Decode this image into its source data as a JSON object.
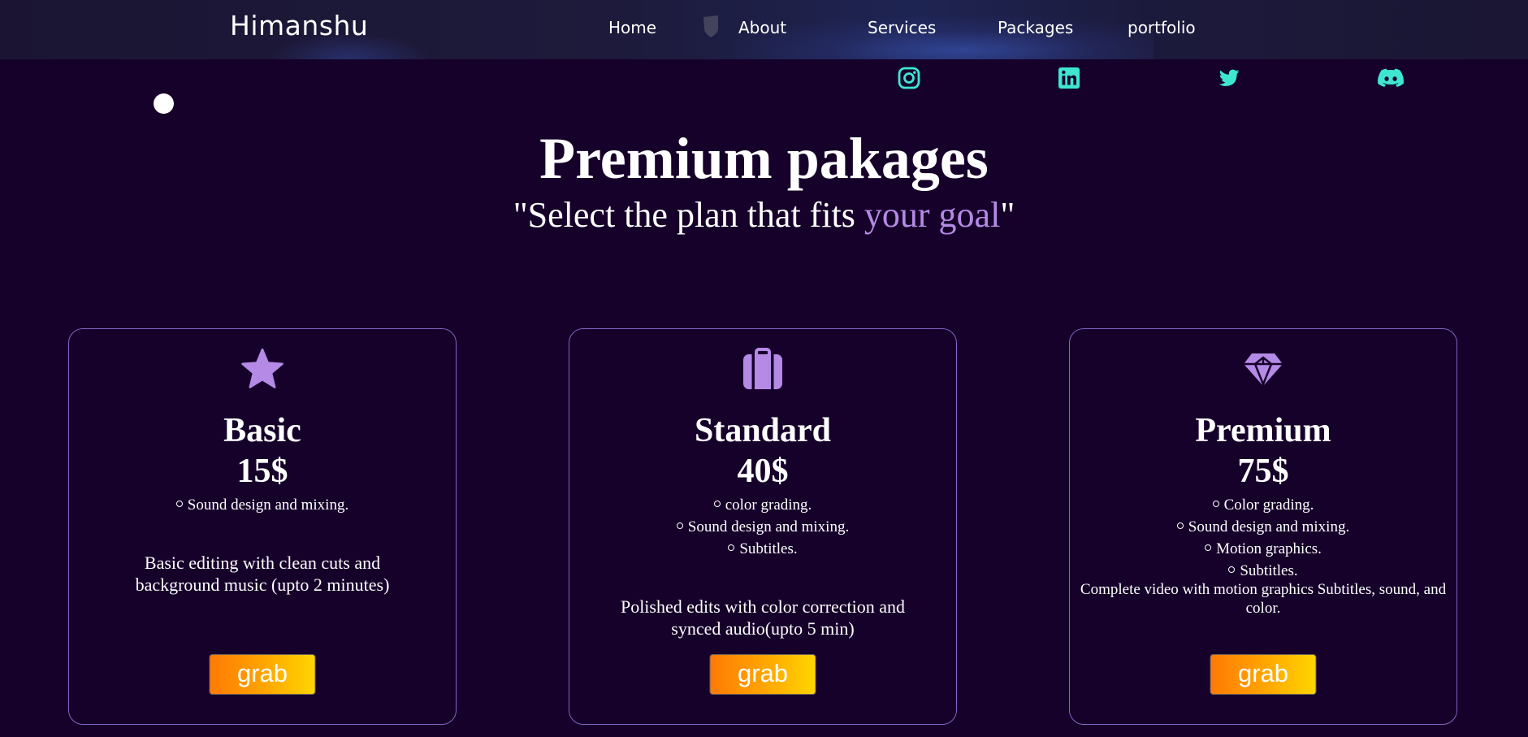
{
  "nav": {
    "brand": "Himanshu",
    "links": [
      {
        "label": "Home"
      },
      {
        "label": "About"
      },
      {
        "label": "Services"
      },
      {
        "label": "Packages"
      },
      {
        "label": "portfolio"
      }
    ]
  },
  "social": [
    {
      "icon": "instagram-icon",
      "color": "#3ee6d2"
    },
    {
      "icon": "linkedin-icon",
      "color": "#3ee6d2"
    },
    {
      "icon": "twitter-icon",
      "color": "#3ee6d2"
    },
    {
      "icon": "discord-icon",
      "color": "#3ee6d2"
    }
  ],
  "heading": {
    "title": "Premium pakages",
    "subtitle_open": "\"Select the plan that fits ",
    "subtitle_accent": "your goal",
    "subtitle_close": "\""
  },
  "colors": {
    "background": "#16012a",
    "accent": "#b58ae6",
    "card_border": "#7e66c4",
    "social": "#3ee6d2",
    "button_start": "#ff7a06",
    "button_end": "#ffd500"
  },
  "packages": [
    {
      "icon": "star-icon",
      "name": "Basic",
      "price": "15$",
      "features": [
        "Sound design and mixing."
      ],
      "description": "Basic editing with clean cuts and background music (upto 2 minutes)",
      "button": "grab"
    },
    {
      "icon": "briefcase-icon",
      "name": "Standard",
      "price": "40$",
      "features": [
        "color grading.",
        "Sound design and mixing.",
        "Subtitles."
      ],
      "description": "Polished edits with color correction and synced audio(upto 5 min)",
      "button": "grab"
    },
    {
      "icon": "gem-icon",
      "name": "Premium",
      "price": "75$",
      "features": [
        "Color grading.",
        "Sound design and mixing.",
        "Motion graphics.",
        "Subtitles."
      ],
      "description": "Complete video with motion graphics Subtitles, sound, and color.",
      "button": "grab"
    }
  ]
}
